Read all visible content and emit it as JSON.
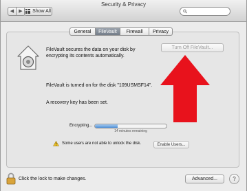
{
  "window": {
    "title": "Security & Privacy"
  },
  "toolbar": {
    "back_icon": "chevron-left-icon",
    "forward_icon": "chevron-right-icon",
    "show_all_label": "Show All",
    "search_placeholder": ""
  },
  "tabs": [
    {
      "label": "General",
      "active": false
    },
    {
      "label": "FileVault",
      "active": true
    },
    {
      "label": "Firewall",
      "active": false
    },
    {
      "label": "Privacy",
      "active": false
    }
  ],
  "filevault": {
    "icon": "filevault-house-icon",
    "description": "FileVault secures the data on your disk by encrypting its contents automatically.",
    "turn_off_label": "Turn Off FileVault...",
    "status": "FileVault is turned on for the disk \"109USMSF14\".",
    "recovery": "A recovery key has been set.",
    "progress_label": "Encrypting...",
    "progress_fraction": 0.32,
    "time_remaining": "14 minutes remaining",
    "warning_text": "Some users are not able to unlock the disk.",
    "enable_users_label": "Enable Users..."
  },
  "annotation": {
    "color": "#e8121c"
  },
  "footer": {
    "lock_text": "Click the lock to make changes.",
    "advanced_label": "Advanced...",
    "help_label": "?"
  }
}
